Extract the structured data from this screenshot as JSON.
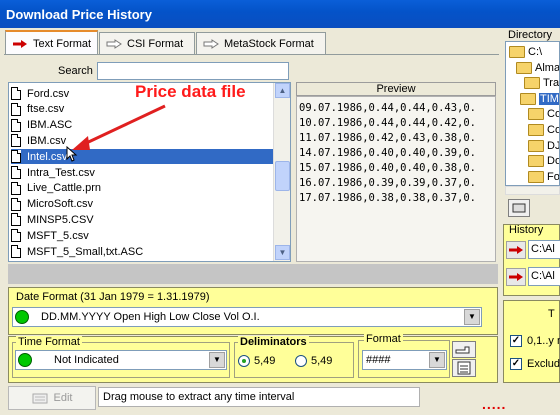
{
  "window": {
    "title": "Download Price History"
  },
  "tabs": [
    {
      "label": "Text Format",
      "active": true
    },
    {
      "label": "CSI Format",
      "active": false
    },
    {
      "label": "MetaStock Format",
      "active": false
    }
  ],
  "search": {
    "label": "Search",
    "value": ""
  },
  "files": [
    "Ford.csv",
    "ftse.csv",
    "IBM.ASC",
    "IBM.csv",
    "Intel.csv",
    "Intra_Test.csv",
    "Live_Cattle.prn",
    "MicroSoft.csv",
    "MINSP5.CSV",
    "MSFT_5.csv",
    "MSFT_5_Small,txt.ASC"
  ],
  "selected_file_index": 4,
  "annotation": "Price data file",
  "preview": {
    "header": "Preview",
    "lines": [
      "09.07.1986,0.44,0.44,0.43,0.",
      "10.07.1986,0.44,0.44,0.42,0.",
      "11.07.1986,0.42,0.43,0.38,0.",
      "14.07.1986,0.40,0.40,0.39,0.",
      "15.07.1986,0.40,0.40,0.38,0.",
      "16.07.1986,0.39,0.39,0.37,0.",
      "17.07.1986,0.38,0.38,0.37,0."
    ]
  },
  "date_format": {
    "label": "Date Format (31 Jan 1979  =  1.31.1979)",
    "value": "DD.MM.YYYY  Open High Low Close Vol  O.I."
  },
  "time_format": {
    "label": "Time Format",
    "value": "Not Indicated"
  },
  "deliminators": {
    "label": "Deliminators",
    "options": [
      "5,49",
      "5,49"
    ],
    "selected": 0
  },
  "format": {
    "label": "Format",
    "value": "####"
  },
  "edit_button": {
    "label": "Edit"
  },
  "status": {
    "text": "Drag mouse to extract any time interval",
    "dots": "....."
  },
  "directory": {
    "label": "Directory",
    "items": [
      {
        "label": "C:\\",
        "selected": false
      },
      {
        "label": "Alma3",
        "selected": false
      },
      {
        "label": "Trad",
        "selected": false
      },
      {
        "label": "TIM",
        "selected": true
      },
      {
        "label": "Co",
        "selected": false
      },
      {
        "label": "Co",
        "selected": false
      },
      {
        "label": "DJ",
        "selected": false
      },
      {
        "label": "Do",
        "selected": false
      },
      {
        "label": "For",
        "selected": false
      }
    ]
  },
  "history": {
    "label": "History",
    "items": [
      "C:\\Al",
      "C:\\Al"
    ]
  },
  "options": {
    "label": "T",
    "items": [
      {
        "label": "0,1..y n",
        "checked": true
      },
      {
        "label": "Exclud",
        "checked": true
      }
    ]
  }
}
